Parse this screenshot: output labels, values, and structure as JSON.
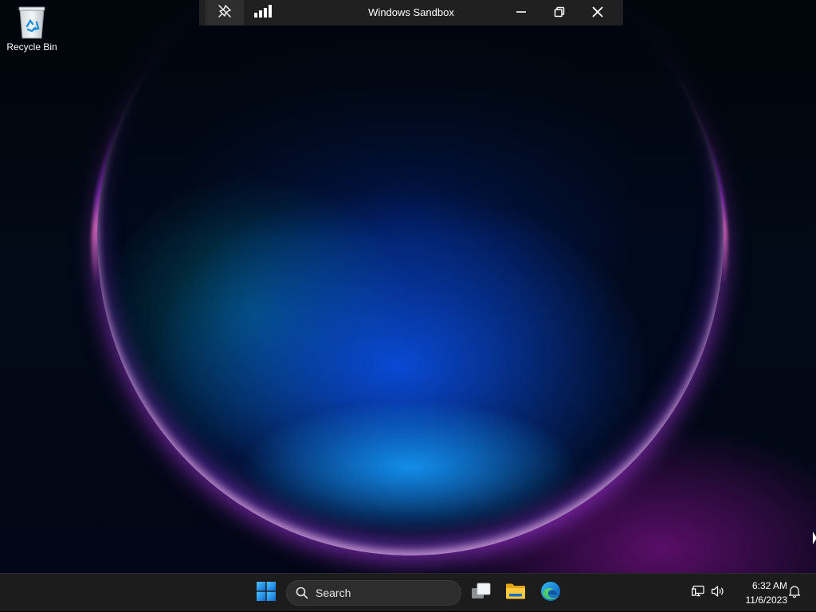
{
  "window": {
    "title": "Windows Sandbox",
    "icons": [
      "pin-icon",
      "connection-strength-icon",
      "minimize-icon",
      "restore-icon",
      "close-icon"
    ]
  },
  "desktop": {
    "icons": [
      {
        "label": "Recycle Bin",
        "icon": "recycle-bin-icon"
      }
    ]
  },
  "taskbar": {
    "start_icon": "windows-logo-icon",
    "search": {
      "placeholder": "Search",
      "icon": "search-icon"
    },
    "pinned": [
      {
        "name": "Task View",
        "icon": "task-view-icon"
      },
      {
        "name": "File Explorer",
        "icon": "folder-icon"
      },
      {
        "name": "Microsoft Edge",
        "icon": "edge-icon"
      }
    ],
    "tray": {
      "network_icon": "network-icon",
      "volume_icon": "volume-icon",
      "time": "6:32 AM",
      "date": "11/6/2023",
      "notifications_icon": "bell-icon"
    }
  },
  "colors": {
    "taskbar_bg": "#1c1c1c",
    "titlebar_bg": "#202020",
    "accent_blue": "#0078d4",
    "wallpaper_glow_pink": "#ff82be",
    "wallpaper_glow_purple": "#b43cff"
  }
}
